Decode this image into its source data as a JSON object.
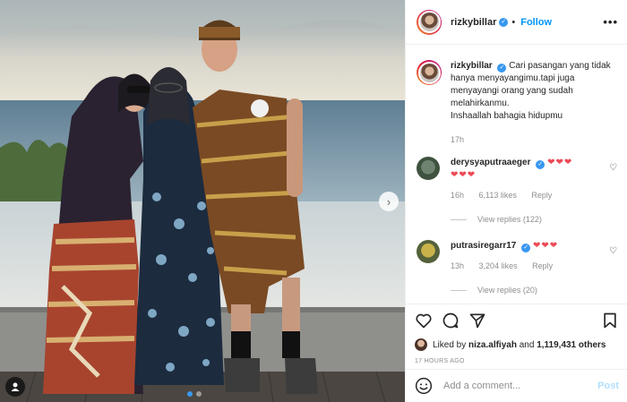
{
  "post": {
    "username": "rizkybillar",
    "verified_icon": "verified-badge-icon",
    "follow_label": "Follow",
    "more_label": "•••",
    "caption": "Cari pasangan yang tidak hanya menyayangimu.tapi juga menyayangi orang yang sudah melahirkanmu.",
    "caption_line2": "Inshaallah bahagia hidupmu",
    "caption_time": "17h"
  },
  "comments": [
    {
      "username": "derysyaputraaeger",
      "text_hearts": "❤❤❤",
      "text_hearts2": "❤❤❤",
      "time": "16h",
      "likes": "6,113 likes",
      "reply_label": "Reply",
      "view_replies": "View replies (122)"
    },
    {
      "username": "putrasiregarr17",
      "text_hearts": "❤❤❤",
      "time": "13h",
      "likes": "3,204 likes",
      "reply_label": "Reply",
      "view_replies": "View replies (20)"
    }
  ],
  "actions": {
    "liked_by_prefix": "Liked by",
    "liked_by_user": "niza.alfiyah",
    "liked_by_and": "and",
    "liked_by_count": "1,119,431 others",
    "time_ago": "17 HOURS AGO"
  },
  "add_comment": {
    "placeholder": "Add a comment...",
    "post_label": "Post"
  },
  "carousel": {
    "next_arrow": "›",
    "slide_count": 2,
    "active_slide": 1
  },
  "colors": {
    "accent": "#0095f6",
    "heart": "#ed4956",
    "muted": "#8e8e8e"
  }
}
